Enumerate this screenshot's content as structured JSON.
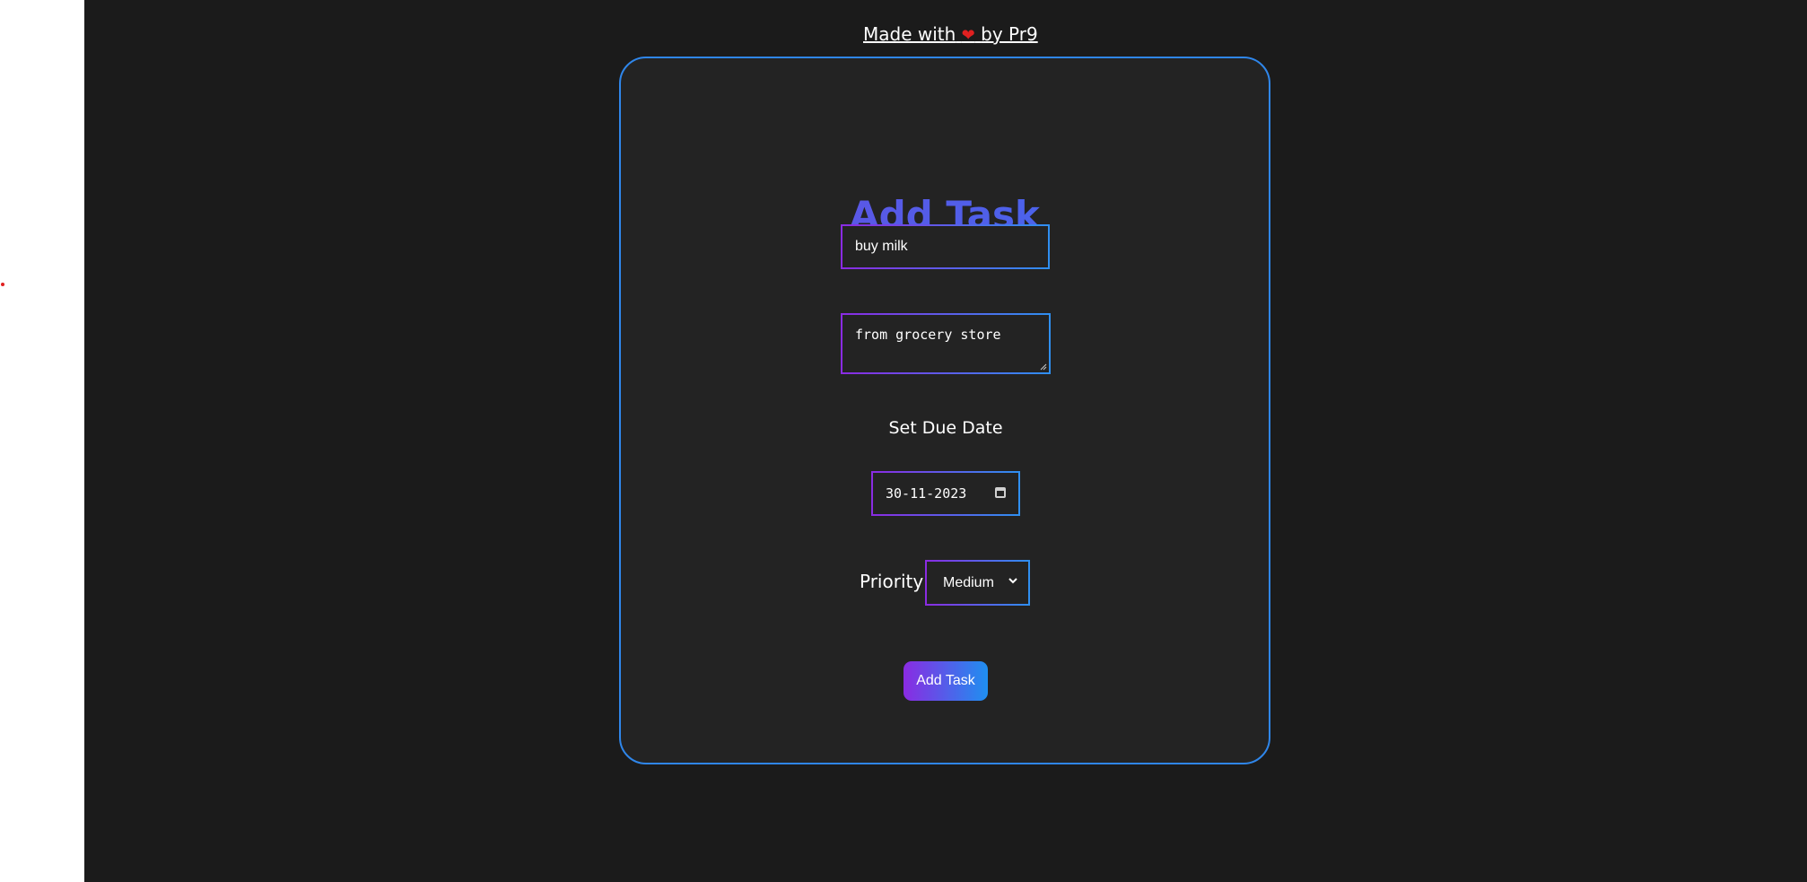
{
  "credit": {
    "prefix": "Made with",
    "heart": "❤",
    "suffix": "by Pr9"
  },
  "form": {
    "heading": "Add Task",
    "title_value": "buy milk",
    "description_value": "from grocery store",
    "due_date_label": "Set Due Date",
    "due_date_value": "30-11-2023",
    "priority_label": "Priority :",
    "priority_value": "Medium",
    "submit_label": "Add Task"
  },
  "colors": {
    "accent_purple": "#8a2be2",
    "accent_blue": "#2f8ff0",
    "card_border": "#2f86ea",
    "background": "#1b1b1b",
    "card_background": "#232323"
  }
}
